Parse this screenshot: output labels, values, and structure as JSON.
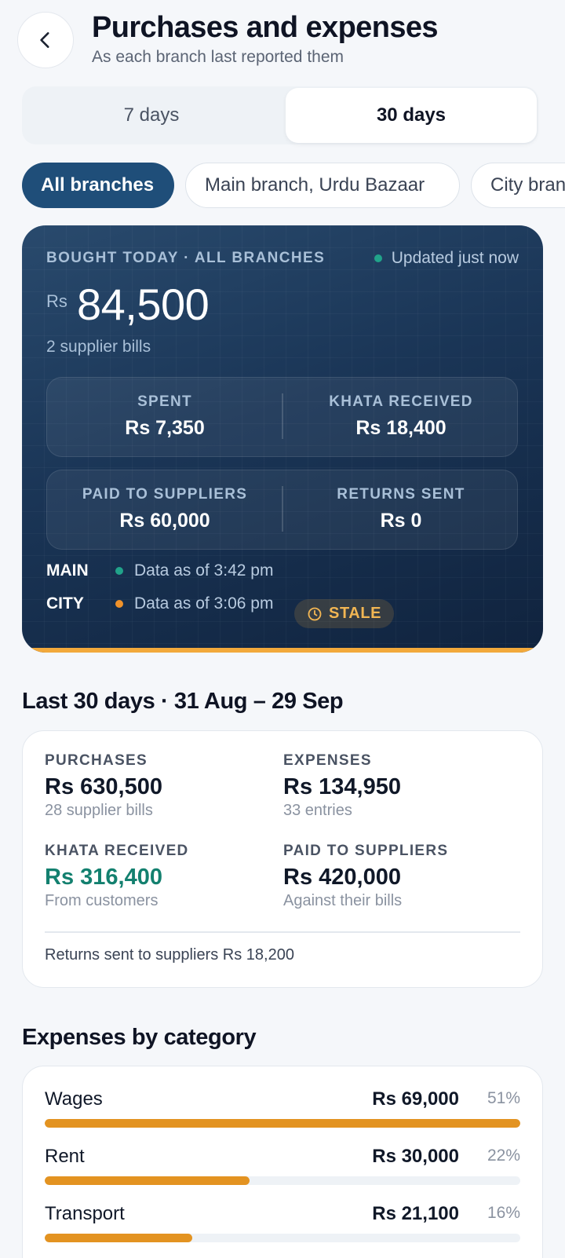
{
  "header": {
    "title": "Purchases and expenses",
    "subtitle": "As each branch last reported them",
    "back_icon": "chevron-left-icon"
  },
  "period_tabs": [
    {
      "label": "7 days",
      "selected": false
    },
    {
      "label": "30 days",
      "selected": true
    }
  ],
  "branch_chips": [
    {
      "label": "All branches",
      "selected": true
    },
    {
      "label": "Main branch, Urdu Bazaar",
      "selected": false
    },
    {
      "label": "City branch",
      "selected": false
    }
  ],
  "today": {
    "kicker": "BOUGHT TODAY · ALL BRANCHES",
    "updated": "Updated just now",
    "currency": "Rs",
    "amount": "84,500",
    "bills": "2 supplier bills",
    "stats": [
      {
        "label": "SPENT",
        "value": "Rs 7,350"
      },
      {
        "label": "KHATA RECEIVED",
        "value": "Rs 18,400"
      },
      {
        "label": "PAID TO SUPPLIERS",
        "value": "Rs 60,000"
      },
      {
        "label": "RETURNS SENT",
        "value": "Rs 0"
      }
    ],
    "branches": [
      {
        "name": "MAIN",
        "status_text": "Data as of 3:42 pm",
        "status_color": "#21a38a"
      },
      {
        "name": "CITY",
        "status_text": "Data as of 3:06 pm",
        "status_color": "#f0922a"
      }
    ],
    "stale_label": "STALE"
  },
  "period_summary": {
    "title": "Last 30 days · 31 Aug – 29 Sep",
    "cells": [
      {
        "label": "PURCHASES",
        "value": "Rs 630,500",
        "sub": "28 supplier bills"
      },
      {
        "label": "EXPENSES",
        "value": "Rs 134,950",
        "sub": "33 entries"
      },
      {
        "label": "KHATA RECEIVED",
        "value": "Rs 316,400",
        "sub": "From customers"
      },
      {
        "label": "PAID TO SUPPLIERS",
        "value": "Rs 420,000",
        "sub": "Against their bills"
      }
    ],
    "returns": "Returns sent to suppliers Rs 18,200"
  },
  "categories": {
    "title": "Expenses by category",
    "items": [
      {
        "name": "Wages",
        "amount": "Rs 69,000",
        "percent_label": "51%",
        "fill": 1.0
      },
      {
        "name": "Rent",
        "amount": "Rs 30,000",
        "percent_label": "22%",
        "fill": 0.43
      },
      {
        "name": "Transport",
        "amount": "Rs 21,100",
        "percent_label": "16%",
        "fill": 0.31
      }
    ]
  },
  "colors": {
    "brand": "#1f4e79",
    "accent": "#e39321",
    "positive": "#13806f",
    "stale": "#f2b653"
  }
}
